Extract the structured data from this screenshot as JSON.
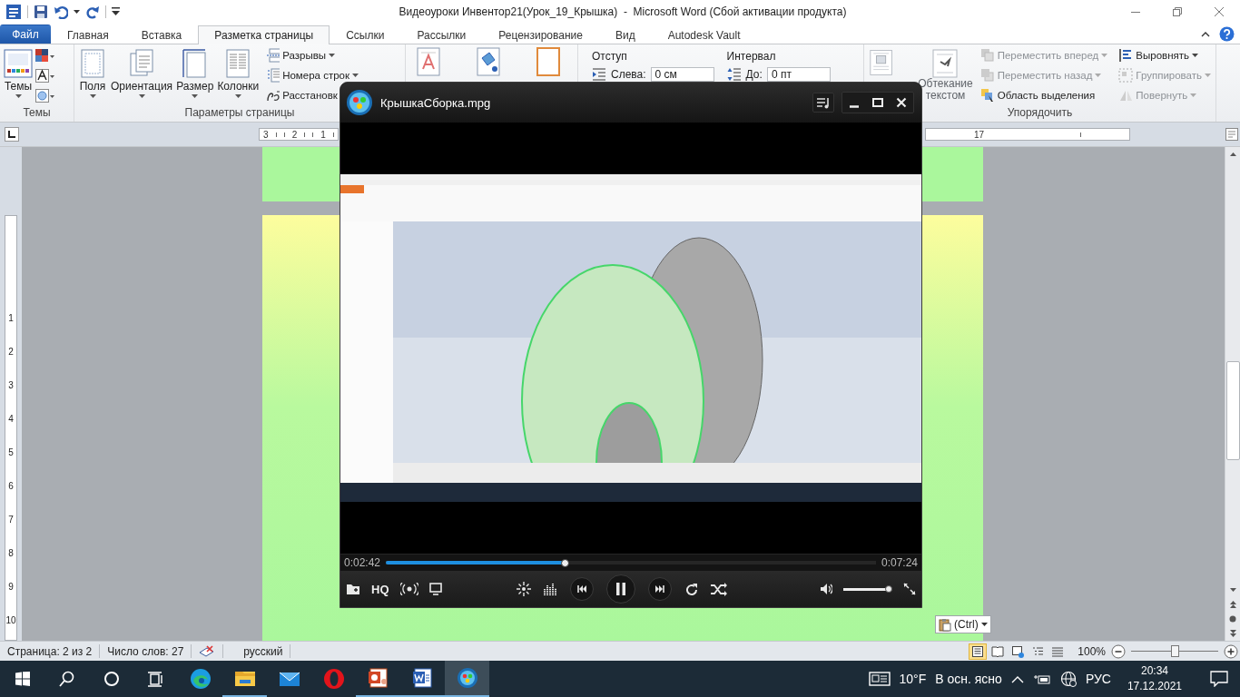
{
  "title_bar": {
    "title": "Видеоуроки Инвентор21(Урок_19_Крышка)  -  Microsoft Word (Сбой активации продукта)"
  },
  "tabs": [
    {
      "label": "Файл",
      "kind": "file",
      "selected": false
    },
    {
      "label": "Главная",
      "kind": "tab",
      "selected": false
    },
    {
      "label": "Вставка",
      "kind": "tab",
      "selected": false
    },
    {
      "label": "Разметка страницы",
      "kind": "tab",
      "selected": true
    },
    {
      "label": "Ссылки",
      "kind": "tab",
      "selected": false
    },
    {
      "label": "Рассылки",
      "kind": "tab",
      "selected": false
    },
    {
      "label": "Рецензирование",
      "kind": "tab",
      "selected": false
    },
    {
      "label": "Вид",
      "kind": "tab",
      "selected": false
    },
    {
      "label": "Autodesk Vault",
      "kind": "tab",
      "selected": false
    }
  ],
  "themes_group": {
    "label": "Темы",
    "button": "Темы"
  },
  "page_setup_group": {
    "label": "Параметры страницы",
    "large_buttons": [
      "Поля",
      "Ориентация",
      "Размер",
      "Колонки"
    ],
    "small_buttons": [
      "Разрывы",
      "Номера строк",
      "Расстановк"
    ]
  },
  "paragraph_group": {
    "indent": {
      "heading": "Отступ",
      "label": "Слева:",
      "value": "0 см"
    },
    "spacing": {
      "heading": "Интервал",
      "label": "До:",
      "value": "0 пт"
    }
  },
  "arrange_group": {
    "label": "Упорядочить",
    "wrap_button": "Обтекание текстом",
    "small_buttons": [
      {
        "label": "Переместить вперед",
        "disabled": true,
        "dropdown": true
      },
      {
        "label": "Переместить назад",
        "disabled": true,
        "dropdown": true
      },
      {
        "label": "Область выделения",
        "disabled": false,
        "dropdown": false
      },
      {
        "label": "Выровнять",
        "disabled": false,
        "dropdown": true
      },
      {
        "label": "Группировать",
        "disabled": true,
        "dropdown": true
      },
      {
        "label": "Повернуть",
        "disabled": true,
        "dropdown": true
      }
    ]
  },
  "ruler": {
    "left_numbers": [
      "3",
      "2",
      "1"
    ],
    "right_numbers": [
      "17"
    ]
  },
  "vertical_ruler": {
    "numbers": [
      "1",
      "2",
      "3",
      "4",
      "5",
      "6",
      "7",
      "8",
      "9",
      "10"
    ]
  },
  "player": {
    "title": "КрышкаСборка.mpg",
    "elapsed": "0:02:42",
    "duration": "0:07:24",
    "progress": {
      "level": 0.365
    },
    "quality": "HQ",
    "playing": true,
    "volume": {
      "level": 0.93
    }
  },
  "paste_options": {
    "label": "(Ctrl)"
  },
  "status_bar": {
    "page": "Страница: 2 из 2",
    "words": "Число слов: 27",
    "language": "русский",
    "zoom": "100%",
    "zoom_slider": {
      "level": 0.5
    },
    "views": [
      {
        "kind": "print",
        "selected": true
      },
      {
        "kind": "reading",
        "selected": false
      },
      {
        "kind": "web",
        "selected": false
      },
      {
        "kind": "outline",
        "selected": false
      },
      {
        "kind": "draft",
        "selected": false
      }
    ]
  },
  "taskbar": {
    "apps": [
      {
        "kind": "edge",
        "running": false,
        "selected": false
      },
      {
        "kind": "explorer",
        "running": true,
        "selected": false
      },
      {
        "kind": "mail",
        "running": false,
        "selected": false
      },
      {
        "kind": "opera",
        "running": false,
        "selected": false
      },
      {
        "kind": "powerpoint",
        "running": true,
        "selected": false
      },
      {
        "kind": "word",
        "running": true,
        "selected": false
      },
      {
        "kind": "player",
        "running": true,
        "selected": true
      }
    ],
    "temperature": "10°F",
    "weather": "В осн. ясно",
    "language": "РУС",
    "time": "20:34",
    "date": "17.12.2021"
  }
}
